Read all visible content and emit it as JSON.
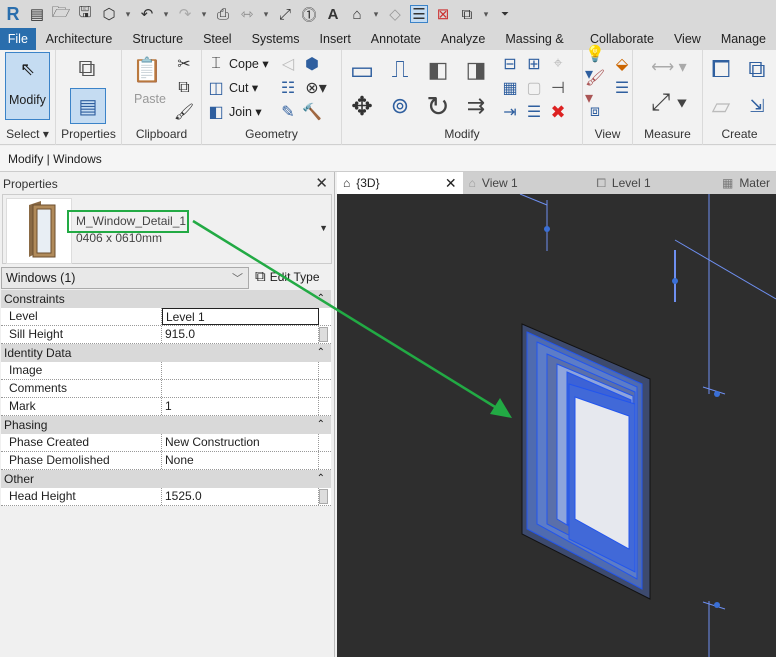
{
  "tabs": [
    "File",
    "Architecture",
    "Structure",
    "Steel",
    "Systems",
    "Insert",
    "Annotate",
    "Analyze",
    "Massing & Site",
    "Collaborate",
    "View",
    "Manage"
  ],
  "ribbon": {
    "modify_label": "Modify",
    "paste_label": "Paste",
    "cope": "Cope",
    "cut": "Cut",
    "join": "Join",
    "panels": {
      "select": "Select",
      "properties": "Properties",
      "clipboard": "Clipboard",
      "geometry": "Geometry",
      "modify": "Modify",
      "view": "View",
      "measure": "Measure",
      "create": "Create"
    }
  },
  "context": "Modify | Windows",
  "properties": {
    "title": "Properties",
    "type_name": "M_Window_Detail_1",
    "type_size": "0406 x 0610mm",
    "filter": "Windows (1)",
    "edit_type": "Edit Type",
    "groups": [
      {
        "name": "Constraints",
        "rows": [
          {
            "k": "Level",
            "v": "Level 1"
          },
          {
            "k": "Sill Height",
            "v": "915.0"
          }
        ]
      },
      {
        "name": "Identity Data",
        "rows": [
          {
            "k": "Image",
            "v": ""
          },
          {
            "k": "Comments",
            "v": ""
          },
          {
            "k": "Mark",
            "v": "1"
          }
        ]
      },
      {
        "name": "Phasing",
        "rows": [
          {
            "k": "Phase Created",
            "v": "New Construction"
          },
          {
            "k": "Phase Demolished",
            "v": "None"
          }
        ]
      },
      {
        "name": "Other",
        "rows": [
          {
            "k": "Head Height",
            "v": "1525.0"
          }
        ]
      }
    ]
  },
  "view_tabs": [
    "{3D}",
    "View 1",
    "Level 1",
    "Mater"
  ],
  "colors": {
    "file_tab": "#2a6ead",
    "annotation": "#22aa44",
    "view_bg": "#2e2e2e",
    "selection": "#3366ff"
  }
}
